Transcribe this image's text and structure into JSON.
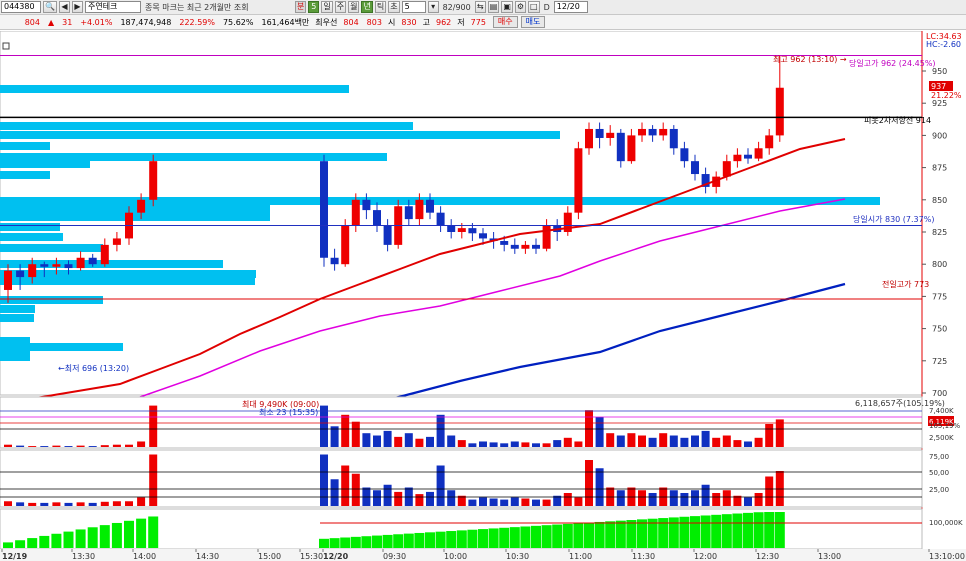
{
  "toolbar": {
    "code": "044380",
    "name": "주연테크",
    "notice": "종목 마크는 최근 2개월만 조회",
    "btn_min": "분",
    "btn_5": "5",
    "btn_day": "일",
    "btn_week": "주",
    "btn_month": "월",
    "btn_year": "년",
    "btn_tick": "틱",
    "btn_sec": "초",
    "period_value": "5",
    "count": "82/900",
    "date_flag": "D",
    "date_value": "12/20"
  },
  "quote": {
    "price": "804",
    "change": "31",
    "change_pct": "+4.01%",
    "volume": "187,474,948",
    "vol_ratio": "222.59%",
    "turnover": "75.62%",
    "amount": "161,464백만",
    "best_ask_label": "최우선",
    "best_ask": "804",
    "best_bid": "803",
    "open_label": "시",
    "open": "830",
    "high_label": "고",
    "high": "962",
    "low_label": "저",
    "low": "775",
    "buy_btn": "매수",
    "sell_btn": "매도"
  },
  "colors": {
    "up": "#ee0000",
    "down": "#1030c0",
    "ma5": "#e00000",
    "ma20": "#e000e0",
    "ma60": "#0020c0",
    "profile": "#00c0f0",
    "vol_bar_green": "#00ee00"
  },
  "price_axis": {
    "ticks": [
      "950",
      "925",
      "900",
      "875",
      "850",
      "825",
      "800",
      "775",
      "750",
      "725",
      "700"
    ],
    "top_labels": [
      "LC:34.63",
      "HC:-2.60"
    ],
    "current_price_box": "937",
    "current_pct": "21.22%"
  },
  "annotations": {
    "high_note": "최고 962 (13:10) →",
    "day_high": "당일고가 962 (24.45%)",
    "pivot": "피봇2차저항선 914",
    "day_open": "당일시가 830 (7.37%)",
    "prev_high": "전일고가 773",
    "low_note": "←최저 696 (13:20)",
    "vol_max_note": "최대 9,490K (09:00)",
    "vol_min_note": "최소 23 (15:35)",
    "vol_total": "6,118,657주(105.19%)"
  },
  "volume_axis": [
    "7,400K",
    "6,119K",
    "105,19%",
    "2,500K"
  ],
  "osc_axis": [
    "75,00",
    "50,00",
    "25,00"
  ],
  "cum_axis": [
    "100,000K"
  ],
  "time_axis": [
    "12/19",
    "13:30",
    "14:00",
    "14:30",
    "15:00",
    "15:30",
    "12/20",
    "09:30",
    "10:00",
    "10:30",
    "11:00",
    "11:30",
    "12:00",
    "12:30",
    "13:00",
    "13:10:00"
  ],
  "chart_data": {
    "type": "candlestick",
    "sessions": [
      "12/19",
      "12/20"
    ],
    "y_axis_range": [
      680,
      965
    ],
    "candles": [
      [
        780,
        795,
        770,
        800
      ],
      [
        795,
        790,
        780,
        800
      ],
      [
        790,
        800,
        785,
        805
      ],
      [
        800,
        798,
        790,
        802
      ],
      [
        798,
        800,
        792,
        805
      ],
      [
        800,
        797,
        792,
        803
      ],
      [
        797,
        805,
        795,
        810
      ],
      [
        805,
        800,
        798,
        808
      ],
      [
        800,
        815,
        798,
        820
      ],
      [
        815,
        820,
        810,
        825
      ],
      [
        820,
        840,
        815,
        845
      ],
      [
        840,
        850,
        835,
        855
      ],
      [
        850,
        880,
        845,
        885
      ],
      [
        880,
        805,
        798,
        885
      ],
      [
        805,
        800,
        795,
        812
      ],
      [
        800,
        830,
        798,
        835
      ],
      [
        830,
        850,
        825,
        855
      ],
      [
        850,
        842,
        835,
        855
      ],
      [
        842,
        830,
        825,
        848
      ],
      [
        830,
        815,
        810,
        835
      ],
      [
        815,
        845,
        812,
        850
      ],
      [
        845,
        835,
        830,
        850
      ],
      [
        835,
        850,
        830,
        855
      ],
      [
        850,
        840,
        835,
        855
      ],
      [
        840,
        830,
        825,
        845
      ],
      [
        830,
        825,
        820,
        835
      ],
      [
        825,
        828,
        820,
        832
      ],
      [
        828,
        824,
        818,
        832
      ],
      [
        824,
        820,
        815,
        828
      ],
      [
        820,
        818,
        812,
        825
      ],
      [
        818,
        815,
        810,
        822
      ],
      [
        815,
        812,
        808,
        820
      ],
      [
        812,
        815,
        808,
        818
      ],
      [
        815,
        812,
        808,
        820
      ],
      [
        812,
        830,
        810,
        835
      ],
      [
        830,
        825,
        818,
        835
      ],
      [
        825,
        840,
        822,
        845
      ],
      [
        840,
        890,
        835,
        895
      ],
      [
        890,
        905,
        885,
        910
      ],
      [
        905,
        898,
        890,
        910
      ],
      [
        898,
        902,
        892,
        908
      ],
      [
        902,
        880,
        875,
        905
      ],
      [
        880,
        900,
        878,
        905
      ],
      [
        900,
        905,
        895,
        910
      ],
      [
        905,
        900,
        895,
        908
      ],
      [
        900,
        905,
        896,
        910
      ],
      [
        905,
        890,
        885,
        908
      ],
      [
        890,
        880,
        875,
        895
      ],
      [
        880,
        870,
        865,
        885
      ],
      [
        870,
        860,
        855,
        875
      ],
      [
        860,
        868,
        855,
        872
      ],
      [
        868,
        880,
        865,
        885
      ],
      [
        880,
        885,
        875,
        890
      ],
      [
        885,
        882,
        878,
        890
      ],
      [
        882,
        890,
        880,
        895
      ],
      [
        890,
        900,
        885,
        905
      ],
      [
        900,
        937,
        895,
        962
      ]
    ]
  }
}
